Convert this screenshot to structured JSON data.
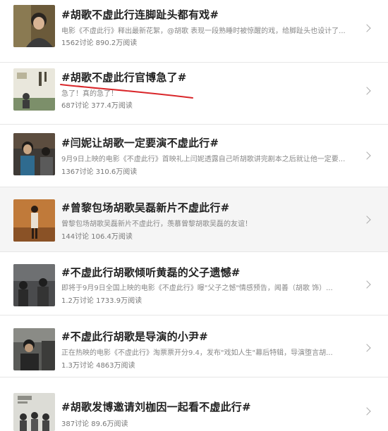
{
  "topics": [
    {
      "title": "#胡歌不虚此行连脚趾头都有戏#",
      "desc": "电影《不虚此行》释出最新花絮，@胡歌 表现一段熟睡时被惊醒的戏，给脚趾头也设计了...",
      "stats": "1562讨论 890.2万阅读"
    },
    {
      "title": "#胡歌不虚此行官博急了#",
      "desc": "急了！真的急了！",
      "stats": "687讨论 377.4万阅读"
    },
    {
      "title": "#闫妮让胡歌一定要演不虚此行#",
      "desc": "9月9日上映的电影《不虚此行》首映礼上闫妮透露自己听胡歌讲完剧本之后就让他一定要...",
      "stats": "1367讨论 310.6万阅读"
    },
    {
      "title": "#曾黎包场胡歌吴磊新片不虚此行#",
      "desc": "曾黎包场胡歌吴磊新片不虚此行，羡慕曾黎胡歌吴磊的友谊！",
      "stats": "144讨论 106.4万阅读"
    },
    {
      "title": "#不虚此行胡歌倾听黄磊的父子遗憾#",
      "desc": "即将于9月9日全国上映的电影《不虚此行》曝\"父子之憾\"情感预告，闻善（胡歌 饰）...",
      "stats": "1.2万讨论 1733.9万阅读"
    },
    {
      "title": "#不虚此行胡歌是导演的小尹#",
      "desc": "正在热映的电影《不虚此行》淘票票开分9.4，发布\"戏如人生\"幕后特辑，导演堕言胡...",
      "stats": "1.3万讨论 4863万阅读"
    },
    {
      "title": "#胡歌发博邀请刘枷因一起看不虚此行#",
      "desc": "",
      "stats": "387讨论 89.6万阅读"
    }
  ],
  "colors": {
    "title": "#222222",
    "meta": "#888888",
    "shaded_row": "#f5f5f5",
    "annotation_red": "#d9262a"
  },
  "icons": [
    "chevron-right-icon"
  ]
}
